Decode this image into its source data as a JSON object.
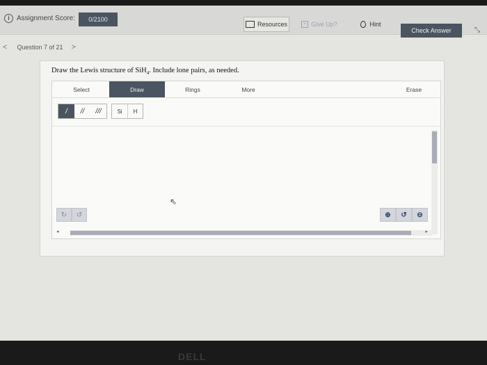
{
  "header": {
    "score_label": "Assignment Score:",
    "score_value": "0/2100",
    "resources_label": "Resources",
    "giveup_label": "Give Up?",
    "hint_label": "Hint",
    "check_answer_label": "Check Answer"
  },
  "question_nav": {
    "prev": "<",
    "label": "Question 7 of 21",
    "next": ">"
  },
  "question": {
    "text_before_sub": "Draw the Lewis structure of SiH",
    "subscript": "4",
    "text_after_sub": ". Include lone pairs, as needed."
  },
  "editor": {
    "tabs": [
      "Select",
      "Draw",
      "Rings",
      "More",
      "Erase"
    ],
    "active_tab": "Draw",
    "bonds": [
      "/",
      "//",
      "///"
    ],
    "atoms": [
      "Si",
      "H"
    ],
    "undo_icon": "↻",
    "redo_icon": "↺",
    "zoom_in_icon": "⊕",
    "zoom_reset_icon": "↺",
    "zoom_out_icon": "⊖"
  },
  "bezel": {
    "logo": "DELL"
  }
}
